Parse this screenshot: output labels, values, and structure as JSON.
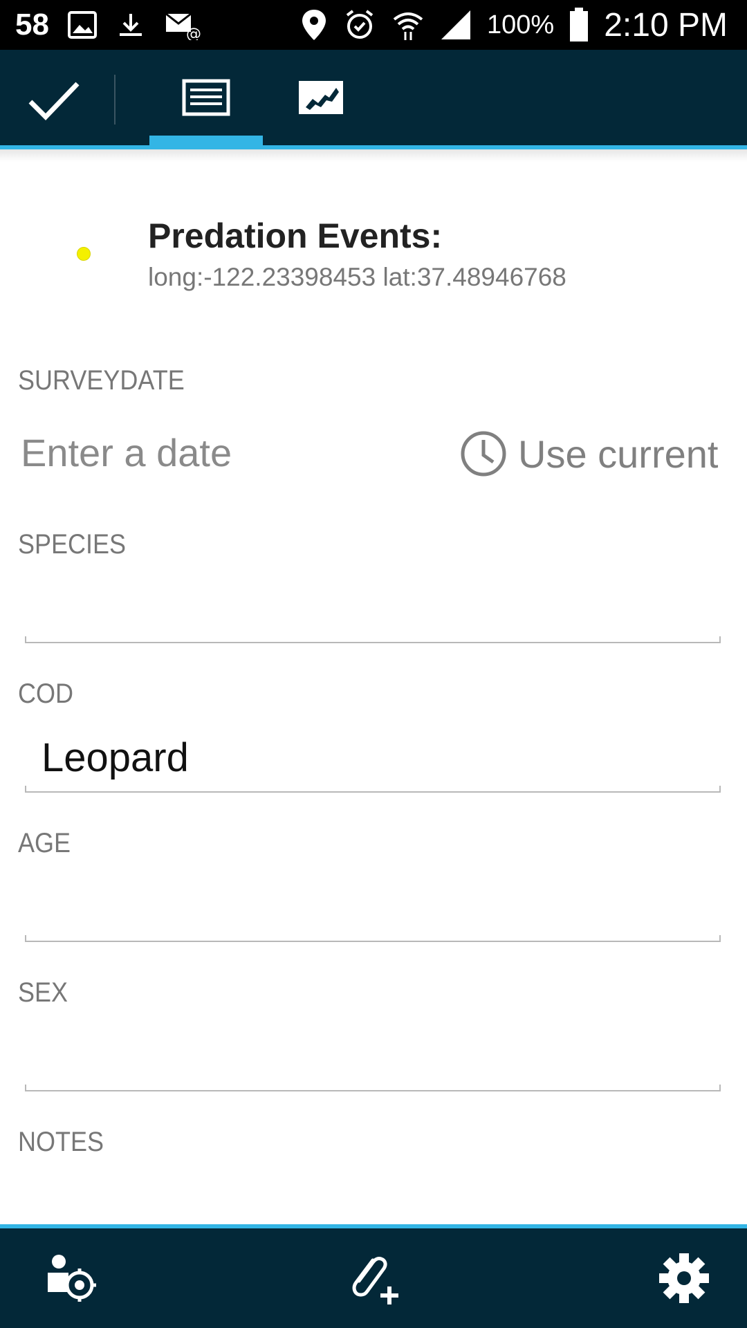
{
  "status_bar": {
    "notification_count": "58",
    "battery": "100%",
    "time": "2:10 PM",
    "left_icons": [
      "image-icon",
      "download-icon",
      "email-icon"
    ],
    "right_icons": [
      "location-icon",
      "alarm-icon",
      "wifi-icon",
      "signal-icon",
      "battery-icon"
    ]
  },
  "toolbar": {
    "tabs": [
      {
        "icon": "form-icon",
        "selected": true
      },
      {
        "icon": "map-icon",
        "selected": false
      }
    ],
    "accent_color": "#33b5e5",
    "bar_color": "#032838"
  },
  "header": {
    "title": "Predation Events:",
    "coordinates": "long:-122.23398453 lat:37.48946768",
    "marker_color": "#f4f000"
  },
  "fields": {
    "surveydate": {
      "label": "SURVEYDATE",
      "placeholder": "Enter a date",
      "use_current_label": "Use current"
    },
    "species": {
      "label": "SPECIES",
      "value": ""
    },
    "cod": {
      "label": "COD",
      "value": "Leopard"
    },
    "age": {
      "label": "AGE",
      "value": ""
    },
    "sex": {
      "label": "SEX",
      "value": ""
    },
    "notes": {
      "label": "NOTES",
      "value": ""
    }
  },
  "bottom_bar": {
    "buttons": [
      "my-location-icon",
      "attach-add-icon",
      "settings-gear-icon"
    ]
  }
}
